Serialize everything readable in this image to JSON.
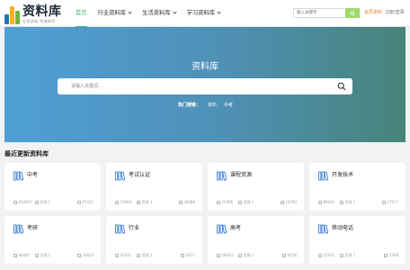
{
  "logo": {
    "title": "资料库",
    "subtitle": "分享资料 传递知识"
  },
  "nav": [
    {
      "label": "首页",
      "active": true,
      "dropdown": false
    },
    {
      "label": "行业资料库",
      "active": false,
      "dropdown": true
    },
    {
      "label": "生活资料库",
      "active": false,
      "dropdown": true
    },
    {
      "label": "学习资料库",
      "active": false,
      "dropdown": true
    }
  ],
  "header_search": {
    "placeholder": "输入关键字"
  },
  "vip_link": "会员资料",
  "login_link": "注册/登录",
  "banner": {
    "title": "资料库",
    "search_placeholder": "请输入关键词...",
    "hot_label": "热门搜索：",
    "hot_tags": [
      "资料",
      "中考"
    ]
  },
  "section_title": "最近更新资料库",
  "cards": [
    {
      "name": "中考",
      "views": "204027",
      "docs": "资源 1",
      "likes": "15437"
    },
    {
      "name": "考试认证",
      "views": "71904",
      "docs": "资源 1",
      "likes": "28486"
    },
    {
      "name": "课程资源",
      "views": "55466",
      "docs": "资源 1",
      "likes": "14793"
    },
    {
      "name": "开发技术",
      "views": "89062",
      "docs": "资源 1",
      "likes": "17977"
    },
    {
      "name": "考研",
      "views": "86687",
      "docs": "资源 1",
      "likes": "20824"
    },
    {
      "name": "行业",
      "views": "42421",
      "docs": "资源 1",
      "likes": "4817"
    },
    {
      "name": "高考",
      "views": "28463",
      "docs": "资源 1",
      "likes": "8226"
    },
    {
      "name": "移动电话",
      "views": "22431",
      "docs": "资源 1",
      "likes": "1308"
    }
  ],
  "colors": {
    "accent": "#3dbb68",
    "vip": "#f07c1a",
    "card_icon": "#3a7bd5"
  }
}
